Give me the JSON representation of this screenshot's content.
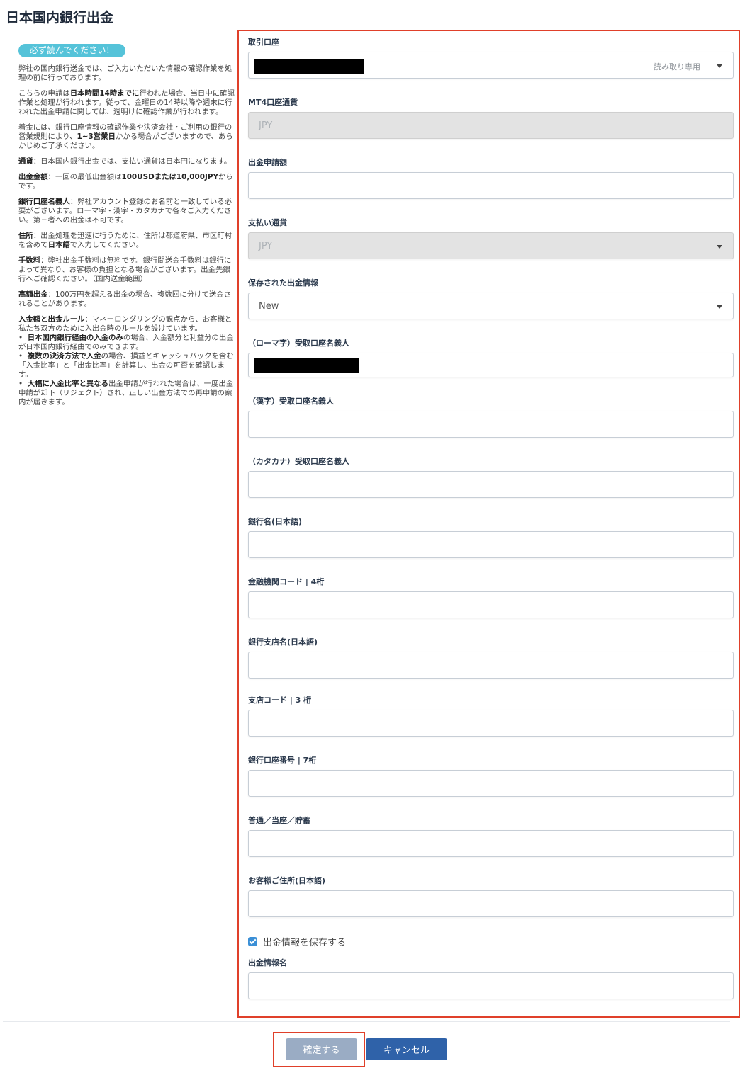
{
  "page_title": "日本国内銀行出金",
  "notice": {
    "badge": "必ず読んでください！",
    "intro": "弊社の国内銀行送金では、ご入力いただいた情報の確認作業を処理の前に行っております。",
    "timing_pre": "こちらの申請は",
    "timing_bold": "日本時間14時までに",
    "timing_post": "行われた場合、当日中に確認作業と処理が行われます。従って、金曜日の14時以降や週末に行われた出金申請に関しては、週明けに確認作業が行われます。",
    "arrival_pre": "着金には、銀行口座情報の確認作業や決済会社・ご利用の銀行の営業規則により、",
    "arrival_bold": "1~3営業日",
    "arrival_post": "かかる場合がございますので、あらかじめご了承ください。",
    "currency_bold": "通貨",
    "currency_text": "：日本国内銀行出金では、支払い通貨は日本円になります。",
    "amount_bold": "出金金額",
    "amount_pre": "：一回の最低出金額は",
    "amount_bold2": "100USDまたは10,000JPY",
    "amount_post": "からです。",
    "holder_bold": "銀行口座名義人",
    "holder_text": "：弊社アカウント登録のお名前と一致している必要がございます。ローマ字・漢字・カタカナで各々ご入力ください。第三者への出金は不可です。",
    "address_bold": "住所",
    "address_pre": "：出金処理を迅速に行うために、住所は都道府県、市区町村を含めて",
    "address_bold2": "日本語",
    "address_post": "で入力してください。",
    "fee_bold": "手数料",
    "fee_text": "：弊社出金手数料は無料です。銀行間送金手数料は銀行によって異なり、お客様の負担となる場合がございます。出金先銀行へご確認ください。（国内送金範囲）",
    "large_bold": "高額出金",
    "large_text": "：100万円を超える出金の場合、複数回に分けて送金されることがあります。",
    "rules_bold": "入金額と出金ルール",
    "rules_text": "：マネーロンダリングの観点から、お客様と私たち双方のために入出金時のルールを設けています。",
    "rule1_bold": "日本国内銀行経由の入金のみ",
    "rule1_text": "の場合、入金額分と利益分の出金が日本国内銀行経由でのみできます。",
    "rule2_bold": "複数の決済方法で入金",
    "rule2_text": "の場合、損益とキャッシュバックを含む「入金比率」と「出金比率」を計算し、出金の可否を確認します。",
    "rule3_bold": "大幅に入金比率と異なる",
    "rule3_text": "出金申請が行われた場合は、一度出金申請が却下（リジェクト）され、正しい出金方法での再申請の案内が届きます。"
  },
  "form": {
    "account_label": "取引口座",
    "account_readonly": "読み取り専用",
    "mt4_currency_label": "MT4口座通貨",
    "mt4_currency_value": "JPY",
    "amount_label": "出金申請額",
    "pay_currency_label": "支払い通貨",
    "pay_currency_value": "JPY",
    "saved_info_label": "保存された出金情報",
    "saved_info_value": "New",
    "romaji_label": "（ローマ字）受取口座名義人",
    "kanji_label": "（漢字）受取口座名義人",
    "katakana_label": "（カタカナ）受取口座名義人",
    "bank_name_label": "銀行名(日本語)",
    "bank_code_label": "金融機関コード | 4桁",
    "branch_name_label": "銀行支店名(日本語)",
    "branch_code_label": "支店コード | 3 桁",
    "account_number_label": "銀行口座番号 | 7桁",
    "account_type_label": "普通／当座／貯蓄",
    "address_label": "お客様ご住所(日本語)",
    "save_info_checkbox": "出金情報を保存する",
    "info_name_label": "出金情報名"
  },
  "buttons": {
    "confirm": "確定する",
    "cancel": "キャンセル"
  },
  "colors": {
    "highlight": "#e0402a",
    "badge": "#55c3d9",
    "cancel_button": "#2f62a9",
    "confirm_button": "#9aacc4"
  }
}
